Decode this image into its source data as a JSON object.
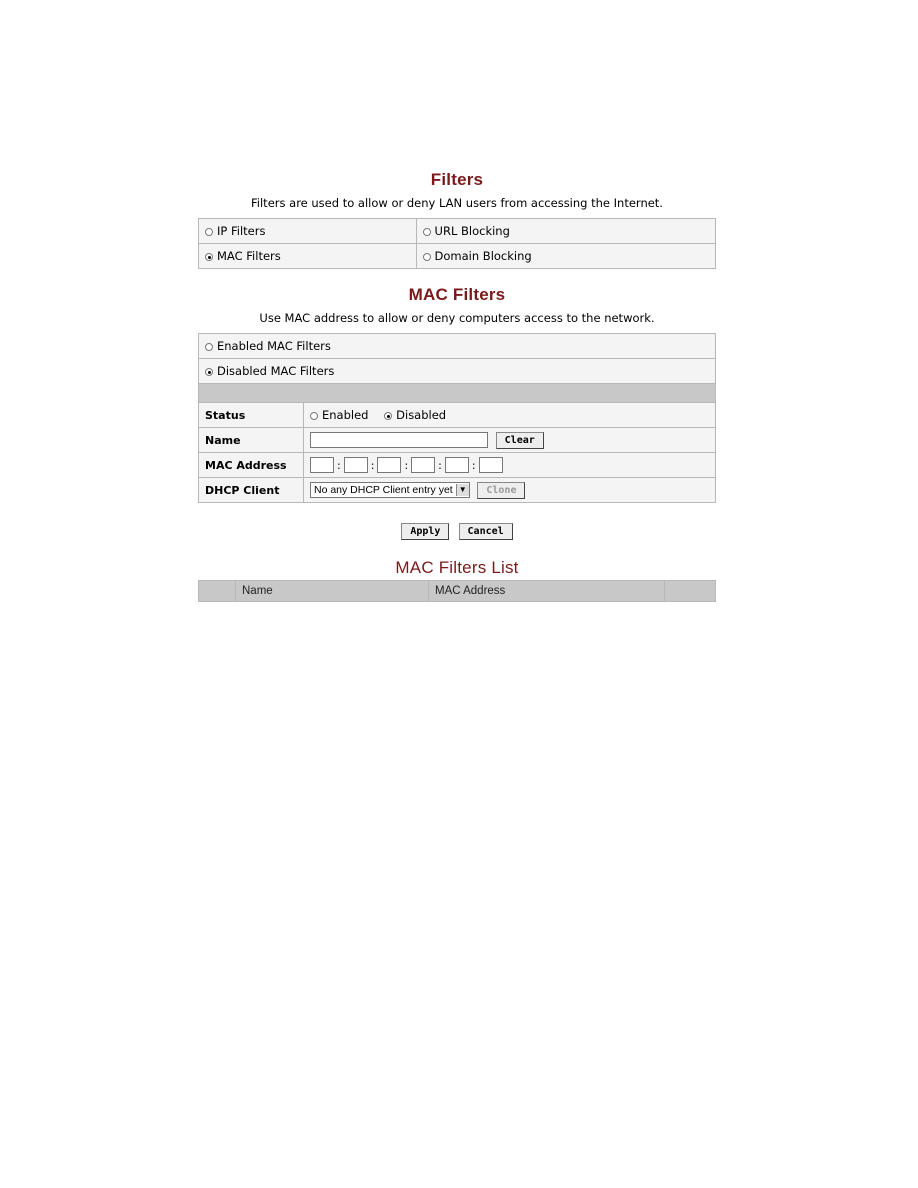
{
  "filters": {
    "title": "Filters",
    "description": "Filters are used to allow or deny LAN users from accessing the Internet.",
    "options": [
      {
        "label": "IP Filters",
        "selected": false
      },
      {
        "label": "URL Blocking",
        "selected": false
      },
      {
        "label": "MAC Filters",
        "selected": true
      },
      {
        "label": "Domain Blocking",
        "selected": false
      }
    ]
  },
  "mac": {
    "title": "MAC Filters",
    "description": "Use MAC address to allow or deny computers access to the network.",
    "modes": [
      {
        "label": "Enabled MAC Filters",
        "selected": false
      },
      {
        "label": "Disabled MAC Filters",
        "selected": true
      }
    ],
    "form": {
      "status_label": "Status",
      "status_enabled": "Enabled",
      "status_disabled": "Disabled",
      "status_value": "Disabled",
      "name_label": "Name",
      "name_value": "",
      "clear_label": "Clear",
      "mac_label": "MAC Address",
      "mac_octets": [
        "",
        "",
        "",
        "",
        "",
        ""
      ],
      "dhcp_label": "DHCP Client",
      "dhcp_selected": "No any DHCP Client entry yet",
      "clone_label": "Clone"
    },
    "apply_label": "Apply",
    "cancel_label": "Cancel"
  },
  "list": {
    "title": "MAC Filters List",
    "columns": [
      "",
      "Name",
      "MAC Address",
      ""
    ]
  }
}
